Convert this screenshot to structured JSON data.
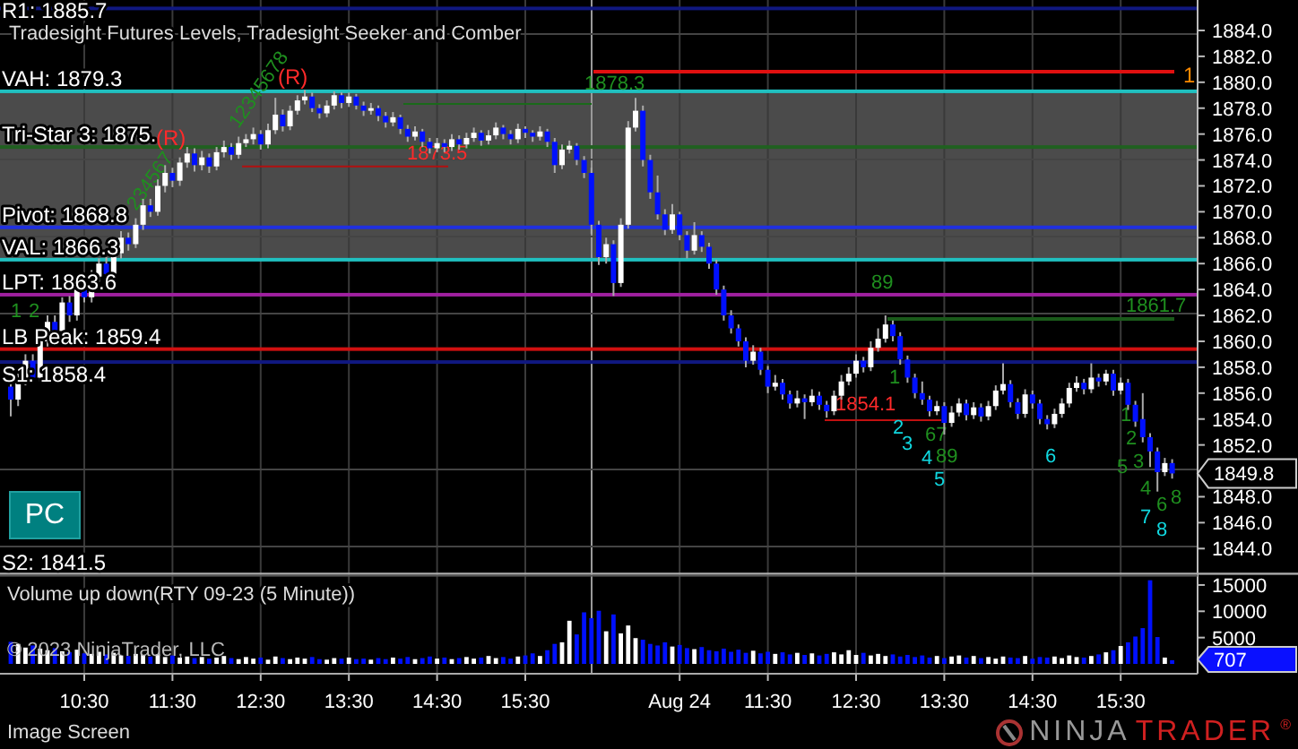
{
  "chart": {
    "title": "Tradesight Futures Levels, Tradesight Seeker and Comber",
    "levels": [
      {
        "label": "R1: 1885.7",
        "color": "#101880"
      },
      {
        "label": "VAH: 1879.3",
        "color": "#20c0c0"
      },
      {
        "label": "Tri-Star 3: 1875.",
        "color": "#206020"
      },
      {
        "label": "Pivot: 1868.8",
        "color": "#2030e0"
      },
      {
        "label": "VAL: 1866.3",
        "color": "#20c0c0"
      },
      {
        "label": "LPT: 1863.6",
        "color": "#a020a0"
      },
      {
        "label": "LB Peak: 1859.4",
        "color": "#d01010"
      },
      {
        "label": "S1: 1858.4",
        "color": "#101880"
      },
      {
        "label": "S2: 1841.5"
      }
    ],
    "annotations": [
      {
        "text": "(R)",
        "kind": "reversal"
      },
      {
        "text": "(R)",
        "kind": "reversal"
      },
      {
        "text": "1873.5",
        "kind": "reversal"
      },
      {
        "text": "1878.3",
        "kind": "count"
      },
      {
        "text": "1861.7",
        "kind": "count"
      },
      {
        "text": "1854.1",
        "kind": "reversal"
      },
      {
        "text": "1",
        "kind": "target"
      },
      {
        "text": "12345678",
        "kind": "count"
      },
      {
        "text": "234567",
        "kind": "count"
      },
      {
        "text": "1",
        "kind": "count"
      },
      {
        "text": "2",
        "kind": "count"
      },
      {
        "text": "89",
        "kind": "count"
      },
      {
        "text": "1",
        "kind": "count"
      },
      {
        "text": "67",
        "kind": "count"
      },
      {
        "text": "89",
        "kind": "count"
      },
      {
        "text": "2",
        "kind": "countdown"
      },
      {
        "text": "3",
        "kind": "countdown"
      },
      {
        "text": "4",
        "kind": "countdown"
      },
      {
        "text": "5",
        "kind": "countdown"
      },
      {
        "text": "6",
        "kind": "countdown"
      },
      {
        "text": "1",
        "kind": "count"
      },
      {
        "text": "2",
        "kind": "count"
      },
      {
        "text": "3",
        "kind": "count"
      },
      {
        "text": "4",
        "kind": "count"
      },
      {
        "text": "5",
        "kind": "count"
      },
      {
        "text": "6",
        "kind": "count"
      },
      {
        "text": "8",
        "kind": "count"
      },
      {
        "text": "7",
        "kind": "countdown"
      },
      {
        "text": "8",
        "kind": "countdown"
      }
    ],
    "chart_data": {
      "type": "candlestick",
      "ylim": [
        1842,
        1886.35
      ],
      "yticks": [
        {
          "value": 1884,
          "label": "1884.0"
        },
        {
          "value": 1882,
          "label": "1882.0"
        },
        {
          "value": 1880,
          "label": "1880.0"
        },
        {
          "value": 1878,
          "label": "1878.0"
        },
        {
          "value": 1876,
          "label": "1876.0"
        },
        {
          "value": 1874,
          "label": "1874.0"
        },
        {
          "value": 1872,
          "label": "1872.0"
        },
        {
          "value": 1870,
          "label": "1870.0"
        },
        {
          "value": 1868,
          "label": "1868.0"
        },
        {
          "value": 1866,
          "label": "1866.0"
        },
        {
          "value": 1864,
          "label": "1864.0"
        },
        {
          "value": 1862,
          "label": "1862.0"
        },
        {
          "value": 1860,
          "label": "1860.0"
        },
        {
          "value": 1858,
          "label": "1858.0"
        },
        {
          "value": 1856,
          "label": "1856.0"
        },
        {
          "value": 1854,
          "label": "1854.0"
        },
        {
          "value": 1852,
          "label": "1852.0"
        },
        {
          "value": 1848,
          "label": "1848.0"
        },
        {
          "value": 1846,
          "label": "1846.0"
        },
        {
          "value": 1844,
          "label": "1844.0"
        }
      ],
      "ohlc": [
        [
          1856.5,
          1857.2,
          1854.2,
          1855.5
        ],
        [
          1855.5,
          1857.5,
          1855.0,
          1857.0
        ],
        [
          1857.0,
          1859.0,
          1856.6,
          1858.5
        ],
        [
          1858.5,
          1859.0,
          1856.8,
          1857.2
        ],
        [
          1857.2,
          1860.4,
          1856.9,
          1860.0
        ],
        [
          1860.0,
          1862.0,
          1859.6,
          1861.5
        ],
        [
          1861.5,
          1862.0,
          1860.4,
          1860.8
        ],
        [
          1860.8,
          1863.4,
          1860.5,
          1863.0
        ],
        [
          1863.0,
          1863.5,
          1861.5,
          1862.0
        ],
        [
          1862.0,
          1864.5,
          1861.6,
          1864.0
        ],
        [
          1864.0,
          1864.6,
          1863.0,
          1863.4
        ],
        [
          1863.4,
          1865.5,
          1863.0,
          1865.0
        ],
        [
          1865.0,
          1866.4,
          1864.6,
          1866.0
        ],
        [
          1866.0,
          1866.5,
          1864.8,
          1865.2
        ],
        [
          1865.2,
          1867.2,
          1864.9,
          1866.8
        ],
        [
          1866.8,
          1868.5,
          1866.4,
          1868.0
        ],
        [
          1868.0,
          1868.4,
          1867.0,
          1867.5
        ],
        [
          1867.5,
          1869.5,
          1867.2,
          1869.0
        ],
        [
          1869.0,
          1871.0,
          1868.6,
          1870.5
        ],
        [
          1870.5,
          1871.0,
          1869.6,
          1870.0
        ],
        [
          1870.0,
          1872.5,
          1869.7,
          1872.0
        ],
        [
          1872.0,
          1873.6,
          1871.5,
          1873.0
        ],
        [
          1873.0,
          1873.4,
          1871.9,
          1872.4
        ],
        [
          1872.4,
          1874.2,
          1872.0,
          1873.8
        ],
        [
          1873.8,
          1875.0,
          1873.4,
          1874.5
        ],
        [
          1874.5,
          1874.9,
          1873.1,
          1873.6
        ],
        [
          1873.6,
          1874.7,
          1873.2,
          1874.2
        ],
        [
          1874.2,
          1874.5,
          1873.0,
          1873.5
        ],
        [
          1873.5,
          1875.0,
          1873.2,
          1874.6
        ],
        [
          1874.6,
          1875.5,
          1874.2,
          1875.0
        ],
        [
          1875.0,
          1875.3,
          1874.0,
          1874.4
        ],
        [
          1874.4,
          1875.8,
          1874.1,
          1875.3
        ],
        [
          1875.3,
          1876.0,
          1875.0,
          1875.6
        ],
        [
          1875.6,
          1876.5,
          1875.2,
          1876.0
        ],
        [
          1876.0,
          1876.3,
          1874.8,
          1875.2
        ],
        [
          1875.2,
          1876.8,
          1874.9,
          1876.3
        ],
        [
          1876.3,
          1878.8,
          1876.0,
          1877.5
        ],
        [
          1877.5,
          1877.9,
          1876.2,
          1876.6
        ],
        [
          1876.6,
          1878.2,
          1876.3,
          1877.8
        ],
        [
          1877.8,
          1879.0,
          1877.5,
          1878.6
        ],
        [
          1878.6,
          1879.4,
          1878.3,
          1878.9
        ],
        [
          1878.9,
          1879.2,
          1877.7,
          1878.0
        ],
        [
          1878.0,
          1878.3,
          1877.2,
          1877.6
        ],
        [
          1877.6,
          1878.6,
          1877.3,
          1878.2
        ],
        [
          1878.2,
          1879.3,
          1877.9,
          1879.0
        ],
        [
          1879.0,
          1879.2,
          1878.0,
          1878.4
        ],
        [
          1878.4,
          1879.2,
          1878.1,
          1878.9
        ],
        [
          1878.9,
          1879.1,
          1877.9,
          1878.2
        ],
        [
          1878.2,
          1878.5,
          1877.4,
          1877.8
        ],
        [
          1877.8,
          1878.4,
          1877.5,
          1878.0
        ],
        [
          1878.0,
          1878.2,
          1877.0,
          1877.4
        ],
        [
          1877.4,
          1877.7,
          1876.5,
          1876.9
        ],
        [
          1876.9,
          1877.7,
          1876.6,
          1877.3
        ],
        [
          1877.3,
          1877.5,
          1876.0,
          1876.4
        ],
        [
          1876.4,
          1876.7,
          1875.4,
          1875.8
        ],
        [
          1875.8,
          1876.6,
          1875.5,
          1876.2
        ],
        [
          1876.2,
          1876.4,
          1875.0,
          1875.4
        ],
        [
          1875.4,
          1875.7,
          1874.5,
          1874.9
        ],
        [
          1874.9,
          1875.7,
          1874.6,
          1875.3
        ],
        [
          1875.3,
          1875.6,
          1874.6,
          1875.0
        ],
        [
          1875.0,
          1876.0,
          1874.7,
          1875.6
        ],
        [
          1875.6,
          1875.9,
          1874.8,
          1875.2
        ],
        [
          1875.2,
          1876.1,
          1874.9,
          1875.7
        ],
        [
          1875.7,
          1876.5,
          1875.4,
          1876.1
        ],
        [
          1876.1,
          1876.3,
          1875.1,
          1875.5
        ],
        [
          1875.5,
          1876.3,
          1875.2,
          1875.9
        ],
        [
          1875.9,
          1876.9,
          1875.6,
          1876.5
        ],
        [
          1876.5,
          1876.7,
          1875.6,
          1876.0
        ],
        [
          1876.0,
          1876.3,
          1875.2,
          1875.6
        ],
        [
          1875.6,
          1876.8,
          1875.3,
          1876.4
        ],
        [
          1876.4,
          1876.6,
          1875.7,
          1876.1
        ],
        [
          1876.1,
          1876.3,
          1875.4,
          1875.8
        ],
        [
          1875.8,
          1876.6,
          1875.5,
          1876.2
        ],
        [
          1876.2,
          1876.4,
          1875.0,
          1875.4
        ],
        [
          1875.4,
          1875.7,
          1873.0,
          1873.6
        ],
        [
          1873.6,
          1875.2,
          1873.3,
          1874.8
        ],
        [
          1874.8,
          1875.5,
          1874.5,
          1875.1
        ],
        [
          1875.1,
          1875.3,
          1873.6,
          1874.0
        ],
        [
          1874.0,
          1874.3,
          1872.6,
          1873.0
        ],
        [
          1873.0,
          1873.4,
          1868.3,
          1869.0
        ],
        [
          1869.0,
          1869.3,
          1865.9,
          1866.5
        ],
        [
          1866.5,
          1868.0,
          1866.0,
          1867.5
        ],
        [
          1867.5,
          1867.8,
          1863.5,
          1864.5
        ],
        [
          1864.5,
          1869.5,
          1864.2,
          1869.0
        ],
        [
          1869.0,
          1877.0,
          1868.7,
          1876.5
        ],
        [
          1876.5,
          1878.8,
          1876.2,
          1877.8
        ],
        [
          1877.8,
          1878.2,
          1873.5,
          1874.0
        ],
        [
          1874.0,
          1874.4,
          1871.0,
          1871.5
        ],
        [
          1871.5,
          1872.8,
          1869.4,
          1869.8
        ],
        [
          1869.8,
          1870.2,
          1868.2,
          1868.6
        ],
        [
          1868.6,
          1870.6,
          1868.3,
          1869.8
        ],
        [
          1869.8,
          1870.0,
          1867.8,
          1868.2
        ],
        [
          1868.2,
          1868.5,
          1866.4,
          1867.0
        ],
        [
          1867.0,
          1869.2,
          1866.7,
          1868.2
        ],
        [
          1868.2,
          1868.5,
          1866.9,
          1867.3
        ],
        [
          1867.3,
          1867.6,
          1865.6,
          1866.0
        ],
        [
          1866.0,
          1866.3,
          1863.6,
          1864.0
        ],
        [
          1864.0,
          1864.3,
          1861.6,
          1862.0
        ],
        [
          1862.0,
          1862.4,
          1860.6,
          1861.0
        ],
        [
          1861.0,
          1861.3,
          1859.6,
          1860.0
        ],
        [
          1860.0,
          1860.3,
          1858.0,
          1858.5
        ],
        [
          1858.5,
          1859.7,
          1858.2,
          1859.2
        ],
        [
          1859.2,
          1859.5,
          1857.4,
          1857.8
        ],
        [
          1857.8,
          1858.1,
          1856.0,
          1856.5
        ],
        [
          1856.5,
          1857.4,
          1856.2,
          1856.8
        ],
        [
          1856.8,
          1857.1,
          1855.5,
          1855.9
        ],
        [
          1855.9,
          1856.2,
          1854.8,
          1855.2
        ],
        [
          1855.2,
          1856.2,
          1854.9,
          1855.6
        ],
        [
          1855.6,
          1855.9,
          1854.0,
          1855.3
        ],
        [
          1855.3,
          1856.3,
          1855.0,
          1855.8
        ],
        [
          1855.8,
          1856.1,
          1854.7,
          1855.1
        ],
        [
          1855.1,
          1855.4,
          1854.1,
          1854.6
        ],
        [
          1854.6,
          1856.2,
          1854.3,
          1855.8
        ],
        [
          1855.8,
          1857.4,
          1855.5,
          1856.9
        ],
        [
          1856.9,
          1858.0,
          1856.6,
          1857.5
        ],
        [
          1857.5,
          1859.0,
          1857.2,
          1858.5
        ],
        [
          1858.5,
          1858.8,
          1857.6,
          1858.0
        ],
        [
          1858.0,
          1860.0,
          1857.7,
          1859.5
        ],
        [
          1859.5,
          1861.0,
          1859.2,
          1860.2
        ],
        [
          1860.2,
          1862.0,
          1859.9,
          1861.3
        ],
        [
          1861.3,
          1861.6,
          1860.0,
          1860.4
        ],
        [
          1860.4,
          1860.7,
          1858.2,
          1858.6
        ],
        [
          1858.6,
          1858.9,
          1856.8,
          1857.2
        ],
        [
          1857.2,
          1857.5,
          1855.6,
          1856.0
        ],
        [
          1856.0,
          1856.9,
          1855.1,
          1855.5
        ],
        [
          1855.5,
          1855.8,
          1854.2,
          1854.6
        ],
        [
          1854.6,
          1855.4,
          1854.3,
          1855.0
        ],
        [
          1855.0,
          1855.3,
          1852.8,
          1853.7
        ],
        [
          1853.7,
          1855.0,
          1853.4,
          1854.5
        ],
        [
          1854.5,
          1855.6,
          1854.2,
          1855.2
        ],
        [
          1855.2,
          1855.5,
          1853.9,
          1854.3
        ],
        [
          1854.3,
          1855.3,
          1854.0,
          1854.9
        ],
        [
          1854.9,
          1855.2,
          1853.8,
          1854.2
        ],
        [
          1854.2,
          1855.4,
          1853.9,
          1855.0
        ],
        [
          1855.0,
          1856.6,
          1854.7,
          1856.2
        ],
        [
          1856.2,
          1858.3,
          1855.9,
          1856.7
        ],
        [
          1856.7,
          1857.0,
          1854.9,
          1855.3
        ],
        [
          1855.3,
          1855.6,
          1854.0,
          1854.4
        ],
        [
          1854.4,
          1856.3,
          1854.1,
          1855.9
        ],
        [
          1855.9,
          1856.2,
          1854.8,
          1855.2
        ],
        [
          1855.2,
          1855.5,
          1853.6,
          1854.0
        ],
        [
          1854.0,
          1854.3,
          1853.2,
          1853.6
        ],
        [
          1853.6,
          1854.8,
          1853.3,
          1854.4
        ],
        [
          1854.4,
          1855.6,
          1854.1,
          1855.2
        ],
        [
          1855.2,
          1856.8,
          1854.9,
          1856.4
        ],
        [
          1856.4,
          1857.3,
          1856.1,
          1856.8
        ],
        [
          1856.8,
          1857.1,
          1855.9,
          1856.3
        ],
        [
          1856.3,
          1858.3,
          1856.0,
          1857.2
        ],
        [
          1857.2,
          1857.5,
          1856.5,
          1856.9
        ],
        [
          1856.9,
          1857.8,
          1856.6,
          1857.5
        ],
        [
          1857.5,
          1857.8,
          1855.8,
          1856.2
        ],
        [
          1856.2,
          1857.2,
          1855.9,
          1856.8
        ],
        [
          1856.8,
          1857.1,
          1854.7,
          1855.1
        ],
        [
          1855.1,
          1855.4,
          1853.4,
          1853.8
        ],
        [
          1854.0,
          1856.0,
          1852.2,
          1852.6
        ],
        [
          1852.6,
          1852.9,
          1850.3,
          1851.5
        ],
        [
          1851.5,
          1851.8,
          1848.4,
          1849.9
        ],
        [
          1849.9,
          1851.0,
          1849.6,
          1850.6
        ],
        [
          1850.6,
          1850.9,
          1849.4,
          1849.8
        ]
      ]
    },
    "current_price": "1849.8",
    "pc_button": "PC"
  },
  "volume_pane": {
    "title": "Volume up down(RTY 09-23 (5 Minute))",
    "copyright": "© 2023 NinjaTrader, LLC",
    "chart_data": {
      "type": "bar",
      "ylim": [
        0,
        17000
      ],
      "yticks": [
        {
          "value": 15000,
          "label": "15000"
        },
        {
          "value": 10000,
          "label": "10000"
        },
        {
          "value": 5000,
          "label": "5000"
        }
      ],
      "values": [
        4200,
        3800,
        3100,
        3500,
        2900,
        2600,
        3000,
        2400,
        2200,
        2700,
        2000,
        1900,
        2300,
        1800,
        2100,
        1600,
        1500,
        1900,
        1700,
        1400,
        1800,
        1300,
        1600,
        1200,
        1400,
        1100,
        1300,
        1000,
        1200,
        1500,
        1100,
        900,
        1300,
        1000,
        1200,
        800,
        1400,
        1100,
        900,
        1200,
        1000,
        1300,
        900,
        800,
        1100,
        1000,
        1200,
        900,
        1000,
        800,
        1100,
        900,
        1200,
        1000,
        1300,
        900,
        1100,
        1400,
        1000,
        1200,
        900,
        1100,
        1300,
        1000,
        1200,
        1500,
        1100,
        1300,
        1000,
        1400,
        1600,
        2000,
        1500,
        2600,
        3800,
        4100,
        8200,
        5600,
        9800,
        8700,
        10100,
        6200,
        9400,
        5800,
        7300,
        4900,
        4600,
        3800,
        3500,
        4100,
        3300,
        3600,
        3000,
        2800,
        3200,
        2600,
        2400,
        2900,
        2300,
        2700,
        2100,
        2500,
        2000,
        2300,
        1900,
        2200,
        1800,
        2100,
        1700,
        2000,
        1600,
        1900,
        2200,
        1800,
        2600,
        1700,
        2100,
        1600,
        1900,
        1500,
        1800,
        1400,
        1700,
        1300,
        1600,
        1200,
        1500,
        1100,
        1400,
        1600,
        1200,
        1500,
        1100,
        1300,
        1000,
        1400,
        1200,
        1100,
        1500,
        1000,
        1300,
        1200,
        1400,
        1100,
        1600,
        1300,
        1200,
        1500,
        1800,
        2200,
        2600,
        3400,
        4100,
        5200,
        6800,
        15900,
        5100,
        1200,
        700
      ]
    },
    "current_volume": "707"
  },
  "time_axis": [
    "10:30",
    "11:30",
    "12:30",
    "13:30",
    "14:30",
    "15:30",
    "Aug 24",
    "11:30",
    "12:30",
    "13:30",
    "14:30",
    "15:30"
  ],
  "footer": {
    "status": "Image Screen",
    "logo_first": "NINJA",
    "logo_second": "TRADER",
    "logo_mark": "®"
  }
}
